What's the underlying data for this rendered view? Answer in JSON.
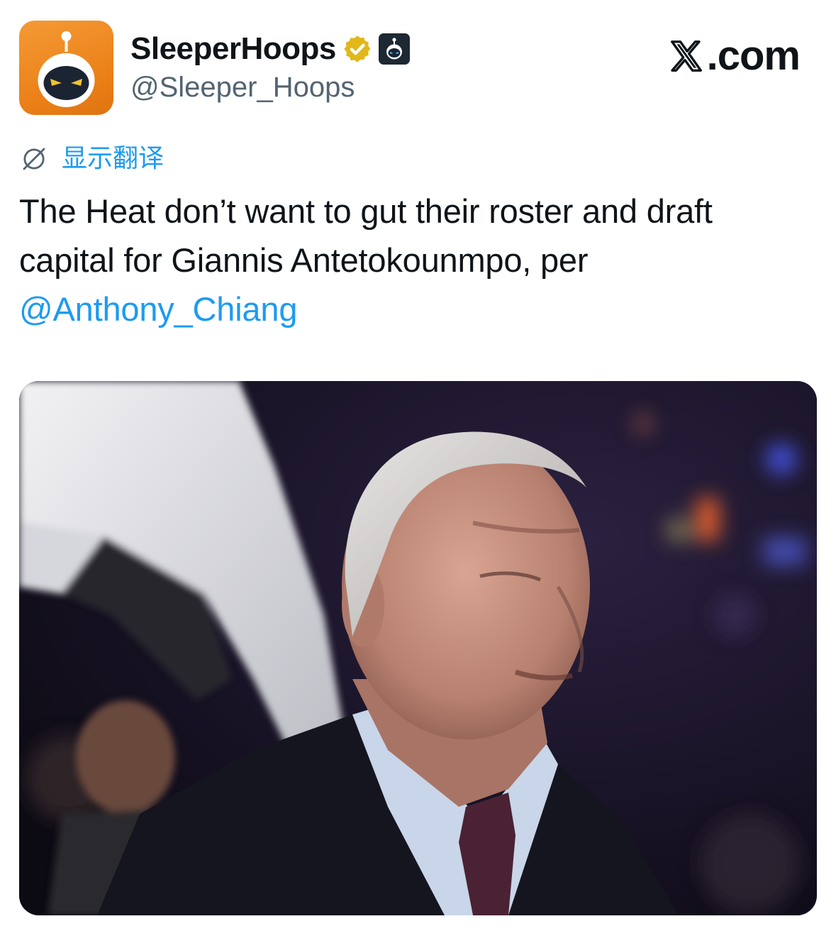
{
  "tweet": {
    "author": {
      "display_name": "SleeperHoops",
      "handle": "@Sleeper_Hoops",
      "avatar_icon": "sleeper-ninja-avatar",
      "verified_badge_icon": "gold-verified-badge-icon",
      "affiliate_badge_icon": "sleeper-affiliate-badge-icon"
    },
    "brand": {
      "logo_icon": "x-logo-icon",
      "text": ".com"
    },
    "translate": {
      "icon": "globe-translate-icon",
      "label": "显示翻译"
    },
    "text": {
      "line1": "The Heat don’t want to gut their roster and draft",
      "line2": "capital for Giannis Antetokounmpo, per",
      "mention": "@Anthony_Chiang"
    },
    "media": {
      "type": "photo"
    }
  },
  "colors": {
    "link": "#1d9bf0",
    "text_primary": "#0f1419",
    "text_secondary": "#536471",
    "verified_gold": "#e2b719",
    "avatar_orange": "#ee8420"
  }
}
